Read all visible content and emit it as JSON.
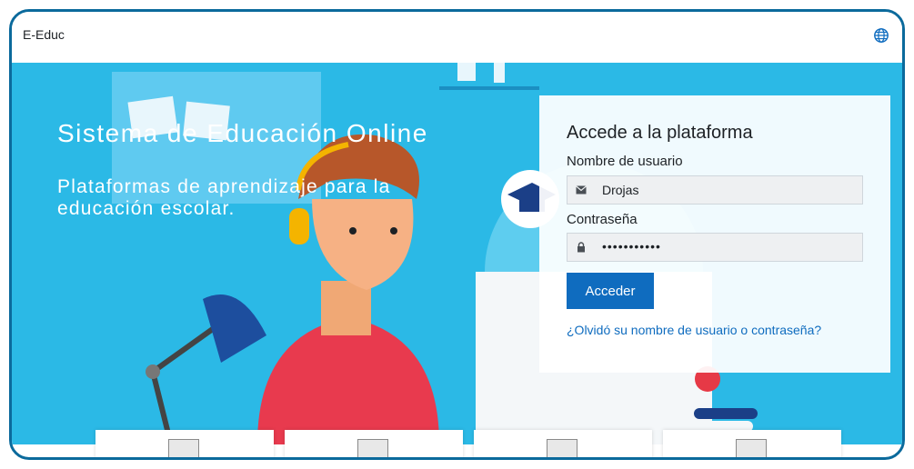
{
  "app": {
    "brand": "E-Educ"
  },
  "hero": {
    "title": "Sistema de Educación Online",
    "subtitle": "Plataformas de aprendizaje para la educación escolar."
  },
  "login": {
    "title": "Accede a la plataforma",
    "username_label": "Nombre de usuario",
    "username_value": "Drojas",
    "password_label": "Contraseña",
    "password_value": "•••••••••••",
    "submit_label": "Acceder",
    "forgot_link": "¿Olvidó su nombre de usuario o contraseña?"
  },
  "icons": {
    "language": "globe-icon",
    "username": "envelope-icon",
    "password": "lock-icon",
    "card": "image-placeholder-icon"
  },
  "colors": {
    "hero_bg": "#2bb9e6",
    "accent": "#0f6cbf",
    "frame": "#0b6a9c"
  },
  "cards": [
    {
      "id": "card-1"
    },
    {
      "id": "card-2"
    },
    {
      "id": "card-3"
    },
    {
      "id": "card-4"
    }
  ]
}
